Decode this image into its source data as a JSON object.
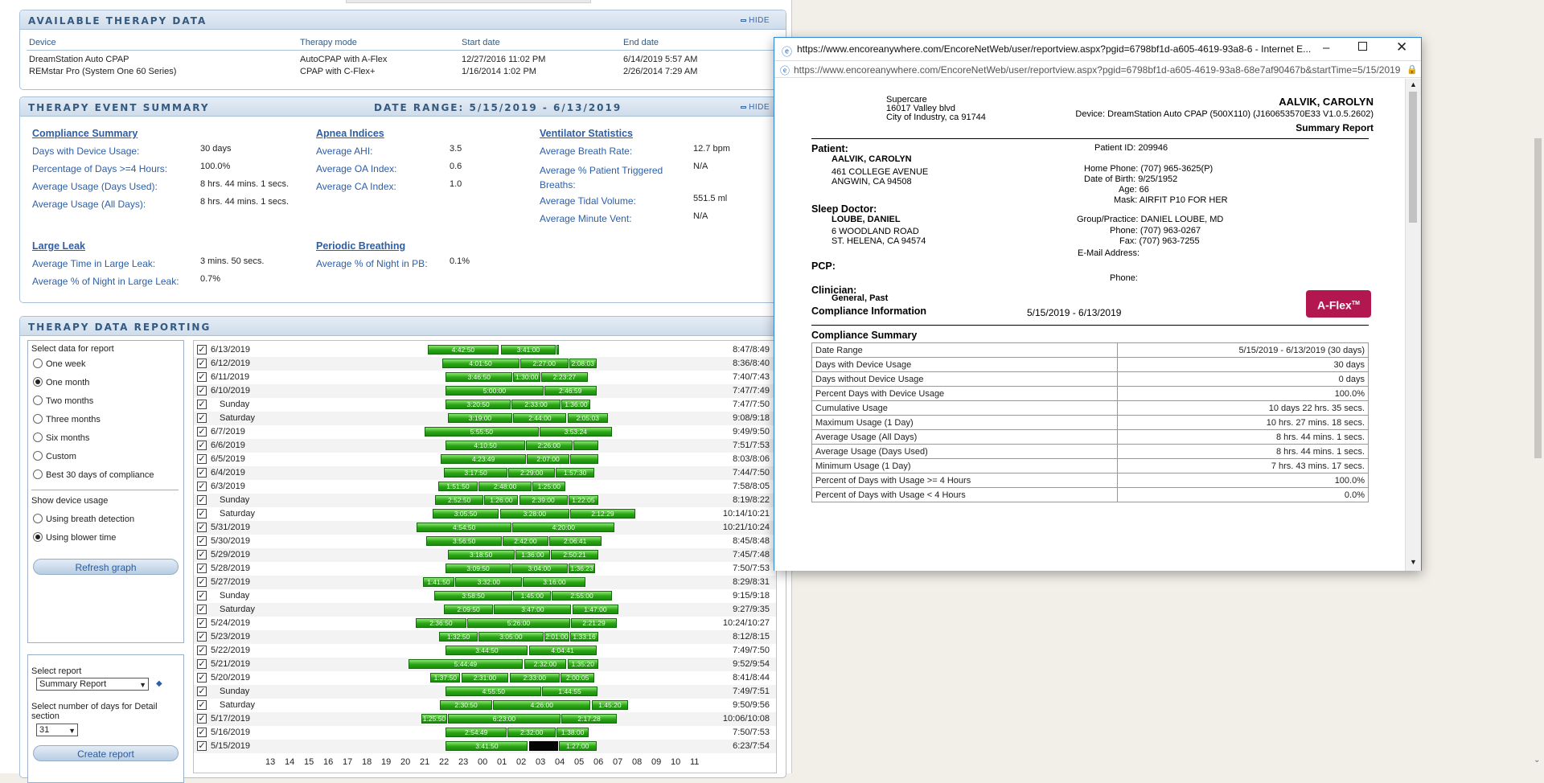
{
  "available_therapy": {
    "title": "AVAILABLE THERAPY DATA",
    "hide_label": "HIDE",
    "columns": [
      "Device",
      "Therapy mode",
      "Start date",
      "End date"
    ],
    "rows": [
      [
        "DreamStation Auto CPAP",
        "AutoCPAP with A-Flex",
        "12/27/2016 11:02 PM",
        "6/14/2019 5:57 AM"
      ],
      [
        "REMstar Pro (System One 60 Series)",
        "CPAP with C-Flex+",
        "1/16/2014 1:02 PM",
        "2/26/2014 7:29 AM"
      ]
    ]
  },
  "event_summary": {
    "title": "THERAPY EVENT SUMMARY",
    "date_range": "DATE RANGE: 5/15/2019 - 6/13/2019",
    "hide_label": "HIDE",
    "compliance": {
      "heading": "Compliance Summary",
      "items": [
        {
          "label": "Days with Device Usage:",
          "value": "30 days"
        },
        {
          "label": "Percentage of Days >=4 Hours:",
          "value": "100.0%"
        },
        {
          "label": "Average Usage (Days Used):",
          "value": "8 hrs. 44 mins. 1 secs."
        },
        {
          "label": "Average Usage (All Days):",
          "value": "8 hrs. 44 mins. 1 secs."
        }
      ]
    },
    "apnea": {
      "heading": "Apnea Indices",
      "items": [
        {
          "label": "Average AHI:",
          "value": "3.5"
        },
        {
          "label": "Average OA Index:",
          "value": "0.6"
        },
        {
          "label": "Average CA Index:",
          "value": "1.0"
        }
      ]
    },
    "ventilator": {
      "heading": "Ventilator Statistics",
      "items": [
        {
          "label": "Average Breath Rate:",
          "value": "12.7 bpm"
        },
        {
          "label": "Average % Patient Triggered Breaths:",
          "value": "N/A"
        },
        {
          "label": "Average Tidal Volume:",
          "value": "551.5 ml"
        },
        {
          "label": "Average Minute Vent:",
          "value": "N/A"
        }
      ]
    },
    "large_leak": {
      "heading": "Large Leak",
      "items": [
        {
          "label": "Average Time in Large Leak:",
          "value": "3 mins. 50 secs."
        },
        {
          "label": "Average % of Night in Large Leak:",
          "value": "0.7%"
        }
      ]
    },
    "periodic": {
      "heading": "Periodic Breathing",
      "items": [
        {
          "label": "Average % of Night in PB:",
          "value": "0.1%"
        }
      ]
    }
  },
  "reporting": {
    "title": "THERAPY DATA REPORTING",
    "select_data_label": "Select data for report",
    "ranges": [
      "One week",
      "One month",
      "Two months",
      "Three months",
      "Six months",
      "Custom",
      "Best 30 days of compliance"
    ],
    "selected_range": "One month",
    "show_usage_label": "Show device usage",
    "usage_options": [
      "Using breath detection",
      "Using blower time"
    ],
    "selected_usage": "Using blower time",
    "refresh_label": "Refresh graph",
    "select_report_label": "Select report",
    "report_value": "Summary Report",
    "detail_days_label": "Select number of days for Detail section",
    "detail_days_value": "31",
    "create_label": "Create report",
    "axis_hours": [
      "13",
      "14",
      "15",
      "16",
      "17",
      "18",
      "19",
      "20",
      "21",
      "22",
      "23",
      "00",
      "01",
      "02",
      "03",
      "04",
      "05",
      "06",
      "07",
      "08",
      "09",
      "10",
      "11"
    ],
    "rows": [
      {
        "date": "6/13/2019",
        "total": "8:47/8:49",
        "segs": [
          {
            "start": 21.15,
            "end": 24.85,
            "label": "4:42:50"
          },
          {
            "start": 24.95,
            "end": 27.8,
            "label": "3:41:00"
          },
          {
            "start": 27.85,
            "end": 27.95,
            "label": ""
          }
        ]
      },
      {
        "date": "6/12/2019",
        "total": "8:36/8:40",
        "segs": [
          {
            "start": 21.9,
            "end": 25.9,
            "label": "4:01:50"
          },
          {
            "start": 25.95,
            "end": 28.45,
            "label": "2:27:00"
          },
          {
            "start": 28.5,
            "end": 29.9,
            "label": "2:08:03"
          }
        ]
      },
      {
        "date": "6/11/2019",
        "total": "7:40/7:43",
        "segs": [
          {
            "start": 22.1,
            "end": 25.55,
            "label": "3:46:50"
          },
          {
            "start": 25.6,
            "end": 27.0,
            "label": "1:30:00"
          },
          {
            "start": 27.05,
            "end": 29.45,
            "label": "2:23:27"
          }
        ]
      },
      {
        "date": "6/10/2019",
        "total": "7:47/7:49",
        "segs": [
          {
            "start": 22.1,
            "end": 27.15,
            "label": "5:00:00"
          },
          {
            "start": 27.2,
            "end": 29.9,
            "label": "2:46:59"
          }
        ]
      },
      {
        "date": "Sunday",
        "total": "7:47/7:50",
        "segs": [
          {
            "start": 22.1,
            "end": 25.45,
            "label": "3:20:50"
          },
          {
            "start": 25.5,
            "end": 28.05,
            "label": "2:33:00"
          },
          {
            "start": 28.1,
            "end": 29.6,
            "label": "1:36:00"
          }
        ]
      },
      {
        "date": "Saturday",
        "total": "9:08/9:18",
        "segs": [
          {
            "start": 22.2,
            "end": 25.55,
            "label": "3:19:00"
          },
          {
            "start": 25.6,
            "end": 28.35,
            "label": "2:44:00"
          },
          {
            "start": 28.4,
            "end": 30.5,
            "label": "2:05:03"
          }
        ]
      },
      {
        "date": "6/7/2019",
        "total": "9:49/9:50",
        "segs": [
          {
            "start": 21.0,
            "end": 26.9,
            "label": "5:55:50"
          },
          {
            "start": 26.95,
            "end": 30.7,
            "label": "3:53:24"
          }
        ]
      },
      {
        "date": "6/6/2019",
        "total": "7:51/7:53",
        "segs": [
          {
            "start": 22.1,
            "end": 26.2,
            "label": "4:10:50"
          },
          {
            "start": 26.25,
            "end": 28.65,
            "label": "2:26:00"
          },
          {
            "start": 28.7,
            "end": 30.0,
            "label": ""
          }
        ]
      },
      {
        "date": "6/5/2019",
        "total": "8:03/8:06",
        "segs": [
          {
            "start": 21.85,
            "end": 26.25,
            "label": "4:23:49"
          },
          {
            "start": 26.3,
            "end": 28.5,
            "label": "2:07:00"
          },
          {
            "start": 28.55,
            "end": 30.0,
            "label": ""
          }
        ]
      },
      {
        "date": "6/4/2019",
        "total": "7:44/7:50",
        "segs": [
          {
            "start": 22.0,
            "end": 25.3,
            "label": "3:17:50"
          },
          {
            "start": 25.35,
            "end": 27.75,
            "label": "2:29:00"
          },
          {
            "start": 27.8,
            "end": 29.8,
            "label": "1:57:30"
          }
        ]
      },
      {
        "date": "6/3/2019",
        "total": "7:58/8:05",
        "segs": [
          {
            "start": 21.7,
            "end": 23.75,
            "label": "1:51:50"
          },
          {
            "start": 23.8,
            "end": 26.55,
            "label": "2:48:00"
          },
          {
            "start": 26.6,
            "end": 28.3,
            "label": "1:25:00"
          }
        ]
      },
      {
        "date": "Sunday",
        "total": "8:19/8:22",
        "segs": [
          {
            "start": 21.55,
            "end": 24.05,
            "label": "2:52:50"
          },
          {
            "start": 24.1,
            "end": 25.85,
            "label": "1:26:00"
          },
          {
            "start": 25.9,
            "end": 28.4,
            "label": "2:39:00"
          },
          {
            "start": 28.45,
            "end": 30.0,
            "label": "1:22:05"
          }
        ]
      },
      {
        "date": "Saturday",
        "total": "10:14/10:21",
        "segs": [
          {
            "start": 21.4,
            "end": 24.85,
            "label": "3:05:50"
          },
          {
            "start": 24.9,
            "end": 28.5,
            "label": "3:28:00"
          },
          {
            "start": 28.55,
            "end": 31.9,
            "label": "2:12:29"
          }
        ]
      },
      {
        "date": "5/31/2019",
        "total": "10:21/10:24",
        "segs": [
          {
            "start": 20.6,
            "end": 25.5,
            "label": "4:54:50"
          },
          {
            "start": 25.55,
            "end": 30.85,
            "label": "4:20:00"
          }
        ]
      },
      {
        "date": "5/30/2019",
        "total": "8:45/8:48",
        "segs": [
          {
            "start": 21.1,
            "end": 25.0,
            "label": "3:56:50"
          },
          {
            "start": 25.05,
            "end": 27.4,
            "label": "2:42:00"
          },
          {
            "start": 27.45,
            "end": 30.15,
            "label": "2:06:41"
          }
        ]
      },
      {
        "date": "5/29/2019",
        "total": "7:45/7:48",
        "segs": [
          {
            "start": 22.2,
            "end": 25.65,
            "label": "3:18:50"
          },
          {
            "start": 25.7,
            "end": 27.5,
            "label": "1:36:00"
          },
          {
            "start": 27.55,
            "end": 30.0,
            "label": "2:50:21"
          }
        ]
      },
      {
        "date": "5/28/2019",
        "total": "7:50/7:53",
        "segs": [
          {
            "start": 22.1,
            "end": 25.45,
            "label": "3:09:50"
          },
          {
            "start": 25.5,
            "end": 28.4,
            "label": "3:04:00"
          },
          {
            "start": 28.45,
            "end": 29.85,
            "label": "1:36:23"
          }
        ]
      },
      {
        "date": "5/27/2019",
        "total": "8:29/8:31",
        "segs": [
          {
            "start": 20.9,
            "end": 22.55,
            "label": "1:41:50"
          },
          {
            "start": 22.6,
            "end": 26.05,
            "label": "3:32:00"
          },
          {
            "start": 26.1,
            "end": 29.35,
            "label": "3:16:00"
          }
        ]
      },
      {
        "date": "Sunday",
        "total": "9:15/9:18",
        "segs": [
          {
            "start": 21.5,
            "end": 25.55,
            "label": "3:58:50"
          },
          {
            "start": 25.6,
            "end": 27.55,
            "label": "1:45:00"
          },
          {
            "start": 27.6,
            "end": 30.7,
            "label": "2:55:00"
          }
        ]
      },
      {
        "date": "Saturday",
        "total": "9:27/9:35",
        "segs": [
          {
            "start": 22.0,
            "end": 24.55,
            "label": "2:09:50"
          },
          {
            "start": 24.6,
            "end": 28.6,
            "label": "3:47:00"
          },
          {
            "start": 28.65,
            "end": 31.05,
            "label": "1:47:00"
          }
        ]
      },
      {
        "date": "5/24/2019",
        "total": "10:24/10:27",
        "segs": [
          {
            "start": 20.55,
            "end": 23.15,
            "label": "2:36:50"
          },
          {
            "start": 23.2,
            "end": 28.55,
            "label": "5:26:00"
          },
          {
            "start": 28.6,
            "end": 30.95,
            "label": "2:21:29"
          }
        ]
      },
      {
        "date": "5/23/2019",
        "total": "8:12/8:15",
        "segs": [
          {
            "start": 21.75,
            "end": 23.75,
            "label": "1:32:50"
          },
          {
            "start": 23.8,
            "end": 27.15,
            "label": "3:05:00"
          },
          {
            "start": 27.2,
            "end": 28.5,
            "label": "2:01:00"
          },
          {
            "start": 28.55,
            "end": 30.0,
            "label": "1:33:16"
          }
        ]
      },
      {
        "date": "5/22/2019",
        "total": "7:49/7:50",
        "segs": [
          {
            "start": 22.1,
            "end": 26.35,
            "label": "3:44:50"
          },
          {
            "start": 26.4,
            "end": 29.9,
            "label": "4:04:41"
          }
        ]
      },
      {
        "date": "5/21/2019",
        "total": "9:52/9:54",
        "segs": [
          {
            "start": 20.15,
            "end": 26.1,
            "label": "5:44:49"
          },
          {
            "start": 26.15,
            "end": 28.35,
            "label": "2:32:00"
          },
          {
            "start": 28.4,
            "end": 30.0,
            "label": "1:35:20"
          }
        ]
      },
      {
        "date": "5/20/2019",
        "total": "8:41/8:44",
        "segs": [
          {
            "start": 21.3,
            "end": 22.85,
            "label": "1:37:50"
          },
          {
            "start": 22.9,
            "end": 25.35,
            "label": "2:31:00"
          },
          {
            "start": 25.4,
            "end": 28.0,
            "label": "2:33:00"
          },
          {
            "start": 28.05,
            "end": 29.8,
            "label": "2:00:05"
          }
        ]
      },
      {
        "date": "Sunday",
        "total": "7:49/7:51",
        "segs": [
          {
            "start": 22.1,
            "end": 27.05,
            "label": "4:55:50"
          },
          {
            "start": 27.1,
            "end": 29.95,
            "label": "1:44:55"
          }
        ]
      },
      {
        "date": "Saturday",
        "total": "9:50/9:56",
        "segs": [
          {
            "start": 21.8,
            "end": 24.5,
            "label": "2:30:50"
          },
          {
            "start": 24.55,
            "end": 29.6,
            "label": "4:26:00"
          },
          {
            "start": 29.65,
            "end": 31.55,
            "label": "1:45:20"
          }
        ]
      },
      {
        "date": "5/17/2019",
        "total": "10:06/10:08",
        "segs": [
          {
            "start": 20.85,
            "end": 22.15,
            "label": "1:25:50"
          },
          {
            "start": 22.2,
            "end": 28.05,
            "label": "6:23:00"
          },
          {
            "start": 28.1,
            "end": 30.95,
            "label": "2:17:28"
          }
        ]
      },
      {
        "date": "5/16/2019",
        "total": "7:50/7:53",
        "segs": [
          {
            "start": 22.1,
            "end": 25.25,
            "label": "2:54:49"
          },
          {
            "start": 25.3,
            "end": 27.8,
            "label": "2:32:00"
          },
          {
            "start": 27.85,
            "end": 29.5,
            "label": "1:38:00"
          }
        ]
      },
      {
        "date": "5/15/2019",
        "total": "6:23/7:54",
        "segs": [
          {
            "start": 22.1,
            "end": 26.35,
            "label": "3:41:50"
          },
          {
            "start": 26.4,
            "end": 27.9,
            "label": "",
            "dark": true
          },
          {
            "start": 27.95,
            "end": 29.9,
            "label": "1:27:00"
          }
        ]
      }
    ]
  },
  "popup": {
    "title_url": "https://www.encoreanywhere.com/EncoreNetWeb/user/reportview.aspx?pgid=6798bf1d-a605-4619-93a8-6 - Internet E...",
    "address_url": "https://www.encoreanywhere.com/EncoreNetWeb/user/reportview.aspx?pgid=6798bf1d-a605-4619-93a8-68e7af90467b&startTime=5/15/2019 1",
    "provider": [
      "Supercare",
      "16017 Valley blvd",
      "City of Industry, ca 91744"
    ],
    "patient_name_top": "AALVIK, CAROLYN",
    "device_line": "Device: DreamStation Auto CPAP (500X110) (J160653570E33 V1.0.5.2602)",
    "report_type": "Summary Report",
    "patient_heading": "Patient:",
    "patient_name": "AALVIK, CAROLYN",
    "patient_addr1": "461 COLLEGE AVENUE",
    "patient_addr2": "ANGWIN, CA 94508",
    "patient_id": "Patient ID: 209946",
    "home_phone": "Home Phone: (707) 965-3625(P)",
    "dob": "Date of Birth: 9/25/1952",
    "age": "Age: 66",
    "mask": "Mask: AIRFIT P10 FOR HER",
    "sleep_doctor_heading": "Sleep Doctor:",
    "doctor_name": "LOUBE, DANIEL",
    "doctor_addr1": "6 WOODLAND ROAD",
    "doctor_addr2": "ST. HELENA, CA 94574",
    "group": "Group/Practice: DANIEL LOUBE, MD",
    "doctor_phone": "Phone: (707) 963-0267",
    "doctor_fax": "Fax: (707) 963-7255",
    "email": "E-Mail Address:",
    "pcp_heading": "PCP:",
    "pcp_phone": "Phone:",
    "clinician_heading": "Clinician:",
    "clinician_value": "General, Past",
    "compliance_info": "Compliance Information",
    "compliance_dates": "5/15/2019 - 6/13/2019",
    "aflex": "A-Flex",
    "summary_heading": "Compliance Summary",
    "summary_rows": [
      [
        "Date Range",
        "5/15/2019 - 6/13/2019 (30 days)"
      ],
      [
        "Days with Device Usage",
        "30 days"
      ],
      [
        "Days without Device Usage",
        "0 days"
      ],
      [
        "Percent Days with Device Usage",
        "100.0%"
      ],
      [
        "Cumulative Usage",
        "10 days 22 hrs. 35 secs."
      ],
      [
        "Maximum Usage (1 Day)",
        "10 hrs. 27 mins. 18 secs."
      ],
      [
        "Average Usage (All Days)",
        "8 hrs. 44 mins. 1 secs."
      ],
      [
        "Average Usage (Days Used)",
        "8 hrs. 44 mins. 1 secs."
      ],
      [
        "Minimum Usage (1 Day)",
        "7 hrs. 43 mins. 17 secs."
      ],
      [
        "Percent of Days with Usage >= 4 Hours",
        "100.0%"
      ],
      [
        "Percent of Days with Usage < 4 Hours",
        "0.0%"
      ]
    ]
  }
}
